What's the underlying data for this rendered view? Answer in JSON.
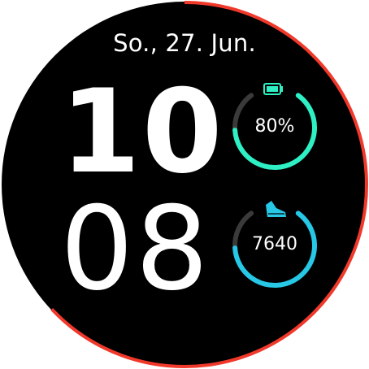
{
  "date": "So., 27. Jun.",
  "time": {
    "hour": "10",
    "minute": "08"
  },
  "battery": {
    "label": "80%",
    "percent": 80,
    "color": "#2ef0c4",
    "icon": "battery-icon"
  },
  "steps": {
    "label": "7640",
    "progress_percent": 80,
    "color": "#27c7e6",
    "icon": "shoe-icon"
  },
  "seconds_progress": {
    "percent": 63,
    "color": "#f0392b"
  },
  "colors": {
    "background": "#000000",
    "text": "#ffffff",
    "track": "#3a3a3a"
  }
}
